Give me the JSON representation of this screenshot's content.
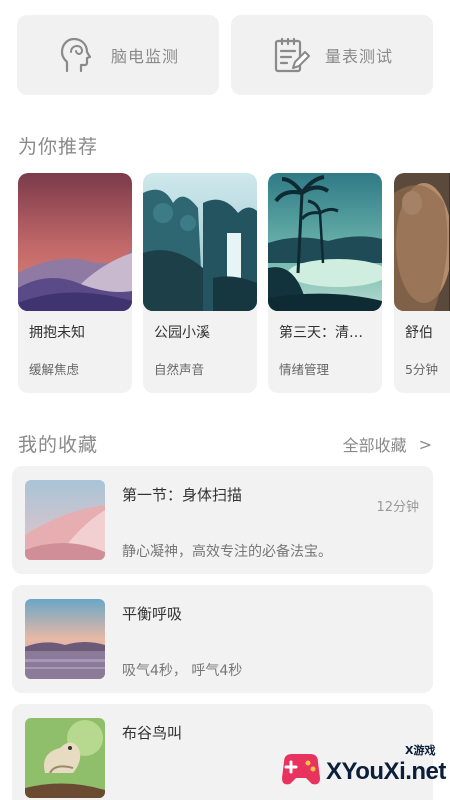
{
  "features": [
    {
      "label": "脑电监测",
      "icon": "brain-head-icon"
    },
    {
      "label": "量表测试",
      "icon": "clipboard-edit-icon"
    }
  ],
  "recommend": {
    "title": "为你推荐",
    "items": [
      {
        "title": "拥抱未知",
        "sub": "缓解焦虑",
        "art": "desert-dunes"
      },
      {
        "title": "公园小溪",
        "sub": "自然声音",
        "art": "waterfall"
      },
      {
        "title": "第三天：清理...",
        "sub": "情绪管理",
        "art": "palm-lagoon"
      },
      {
        "title": "舒伯",
        "sub": "5分钟",
        "art": "portrait"
      }
    ]
  },
  "favorites": {
    "title": "我的收藏",
    "see_all": "全部收藏",
    "see_all_arrow": ">",
    "items": [
      {
        "title": "第一节：身体扫描",
        "sub": "静心凝神，高效专注的必备法宝。",
        "duration": "12分钟",
        "art": "pink-dune"
      },
      {
        "title": "平衡呼吸",
        "sub": "吸气4秒， 呼气4秒",
        "duration": "",
        "art": "sunset-lake"
      },
      {
        "title": "布谷鸟叫",
        "sub": "",
        "duration": "",
        "art": "bird"
      }
    ]
  },
  "watermark": {
    "text": "XYouXi.net",
    "small": "X游戏"
  }
}
